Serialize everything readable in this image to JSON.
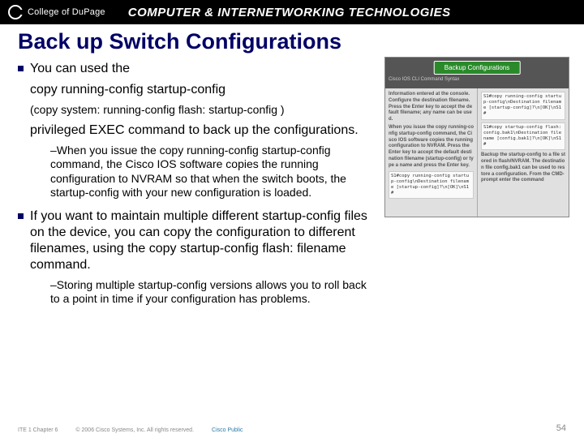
{
  "banner": {
    "college": "College of DuPage",
    "right": "COMPUTER & INTERNETWORKING TECHNOLOGIES"
  },
  "title": "Back up Switch Configurations",
  "bul1": "You can used the",
  "line_cmd1": "copy running-config startup-config",
  "line_cmd2": "(copy system: running-config flash: startup-config )",
  "line_priv": "privileged EXEC command to back up the configurations.",
  "sub1": "–When you issue the copy running-config startup-config command, the Cisco IOS software copies the running configuration to NVRAM so that when the switch boots, the startup-config with your new configuration is loaded.",
  "bul2": "If you want to maintain multiple different startup-config files on the device, you can copy the configuration to different filenames, using the copy startup-config flash: filename command.",
  "sub2": "–Storing multiple startup-config versions allows you to roll back to a point in time if your configuration has problems.",
  "figure": {
    "title": "Backup Configurations",
    "caption": "Cisco IOS CLI Command Syntax",
    "left_step": "Information entered at the console. Configure the destination filename. Press the Enter key to accept the default filename; any name can be used.",
    "left_mono": "S1#copy running-config startup-config\\nDestination filename [startup-config]?\\n[OK]\\nS1#",
    "left_step2": "When you issue the copy running-config startup-config command, the Cisco IOS software copies the running configuration to NVRAM. Press the Enter key to accept the default destination filename (startup-config) or type a name and press the Enter key.",
    "right_step": "S1#copy running-config startup-config\\nDestination filename [startup-config]?\\n[OK]\\nS1#",
    "right_step2": "S1#copy startup-config flash:config.bak1\\nDestination filename [config.bak1]?\\n[OK]\\nS1#",
    "right_text": "Backup the startup-config to a file stored in flash/NVRAM. The destination file config.bak1 can be used to restore a configuration. From the CMD-prompt enter the command"
  },
  "footer": {
    "left": "ITE 1 Chapter 6",
    "mid": "© 2006 Cisco Systems, Inc. All rights reserved.",
    "right": "Cisco Public"
  },
  "slide_num": "54"
}
